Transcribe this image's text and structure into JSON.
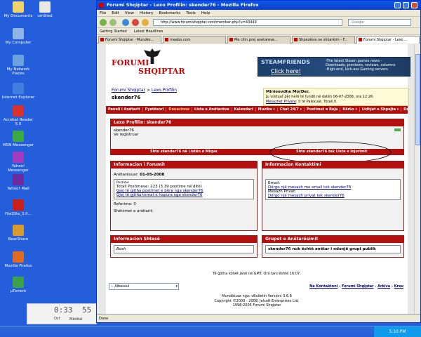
{
  "desktop": {
    "icons": [
      {
        "label": "My Documents",
        "color": "#f1d36b"
      },
      {
        "label": "untitled",
        "color": "#e8e8e8"
      },
      {
        "label": "My Computer",
        "color": "#8fb4e8"
      },
      {
        "label": "My Network Places",
        "color": "#6aa3e0"
      },
      {
        "label": "Internet Explorer",
        "color": "#3f7fe0"
      },
      {
        "label": "Acrobat Reader 5.0",
        "color": "#d8302c"
      },
      {
        "label": "MSN Messenger",
        "color": "#39a845"
      },
      {
        "label": "Yahoo! Messenger",
        "color": "#a23bbf"
      },
      {
        "label": "Yahoo! Mail",
        "color": "#6a2ca0"
      },
      {
        "label": "FileZilla_3.0...",
        "color": "#c9201c"
      },
      {
        "label": "BearShare",
        "color": "#d89a2a"
      },
      {
        "label": "Mozilla Firefox",
        "color": "#e06a20"
      },
      {
        "label": "µTorrent",
        "color": "#3da04a"
      }
    ],
    "gadget": {
      "time1": "0:33",
      "time2": "55",
      "date_label": "Mëdital",
      "weekday": "Oct"
    },
    "clock": "5:10 PM"
  },
  "browser": {
    "title": "Forumi Shqiptar - Lexo Profilin: skender76 - Mozilla Firefox",
    "menu": [
      "File",
      "Edit",
      "View",
      "History",
      "Bookmarks",
      "Tools",
      "Help"
    ],
    "url": "http://www.forumishqiptar.com/member.php?u=43449",
    "search_placeholder": "Google",
    "bookmarks": [
      "Getting Started",
      "Latest Headlines"
    ],
    "tabs": [
      {
        "label": "Forumi Shqiptar - Mundës...",
        "active": false
      },
      {
        "label": "meebo.com",
        "active": false
      },
      {
        "label": "Me cilin prej anetareve...",
        "active": false
      },
      {
        "label": "Shpezësia ne shkarkim - F...",
        "active": false
      },
      {
        "label": "Forumi Shqiptar - Lexo ...",
        "active": true
      }
    ],
    "status": "Done"
  },
  "site": {
    "logo_line1": "FORUMI",
    "logo_line2": "SHQIPTAR",
    "banner": {
      "brand": "STEAMFRIENDS",
      "cta": "Click here!",
      "text": "-The latest Steam games news -Downloads, previews, reviews, columns -High-end, kick-ass Gaming servers"
    },
    "breadcrumb": {
      "home": "Forumi Shqiptar",
      "section": "Lexo Profilin",
      "current": "skender76"
    },
    "welcome": {
      "greeting": "Mirësevdhe MorDer.",
      "last_visit": "Ju vizituat për herë të fundit në datën 06-07-2008, ora 12:26",
      "messages_label": "Mesazhet Private",
      "messages_value": ": 0 të Palexuar, Totali 0."
    },
    "nav": [
      "Paneli i Anëtarit",
      "Pyetësori",
      "Donacione",
      "Lista e Anëtarëve",
      "Kalendari",
      "Muzika ▾",
      "Chat 24/7 ▾",
      "Postimet e Reja",
      "Kërko ▾",
      "Lidhjet e Shpejta ▾",
      "Dalja"
    ],
    "profile": {
      "header": "Lexo Profilin: skender76",
      "username": "skender76",
      "status": "Ve registruar",
      "add_friend": "Shto skender76 në Listën e Miqve",
      "add_ignore": "Shto skender76 tek Lista e Injorimit"
    },
    "info": {
      "header": "Informacion i Forumit",
      "joined_label": "Anëtarësuar:",
      "joined_value": "01-05-2008",
      "posts_legend": "Postime",
      "posts_total": "Totali Postimeve: 223 (3.39 postime në ditë)",
      "link_posts": "Gjej të gjitha postimet e bëra nga skender76",
      "link_threads": "Gjej të gjitha temat e hapura nga skender76",
      "referrals": "Referimo:  0",
      "groups_label": "Shënimet e anëtarit:"
    },
    "contact": {
      "header": "Informacion Kontaktimi",
      "email_label": "Email:",
      "email_link": "Dërgo një mesazh me email tek skender76",
      "pm_label": "Mesazh Privat:",
      "pm_link": "Dërgo një mesazh privat tek skender76"
    },
    "extra": {
      "header": "Informacion Shtesë",
      "value": "Bosh"
    },
    "groups": {
      "header": "Grupet e Anëtarësimit",
      "value": "skender76 nuk është anëtar i ndonjë grupi publik"
    },
    "times": "Të gjitha kohët janë në GMT. Ora tani është 16:07.",
    "style_select": "-- Albasoul",
    "footer_links": [
      "Na Kontaktoni",
      "Forumi Shqiptar",
      "Arkiva",
      "Kreu"
    ],
    "copyright": [
      "Mundësuar nga: vBulletin Versioni 3.6.8",
      "Copyright ©2000 - 2008, Jelsoft Enterprises Ltd.",
      "1998-2005 Forumi Shqiptar"
    ]
  }
}
